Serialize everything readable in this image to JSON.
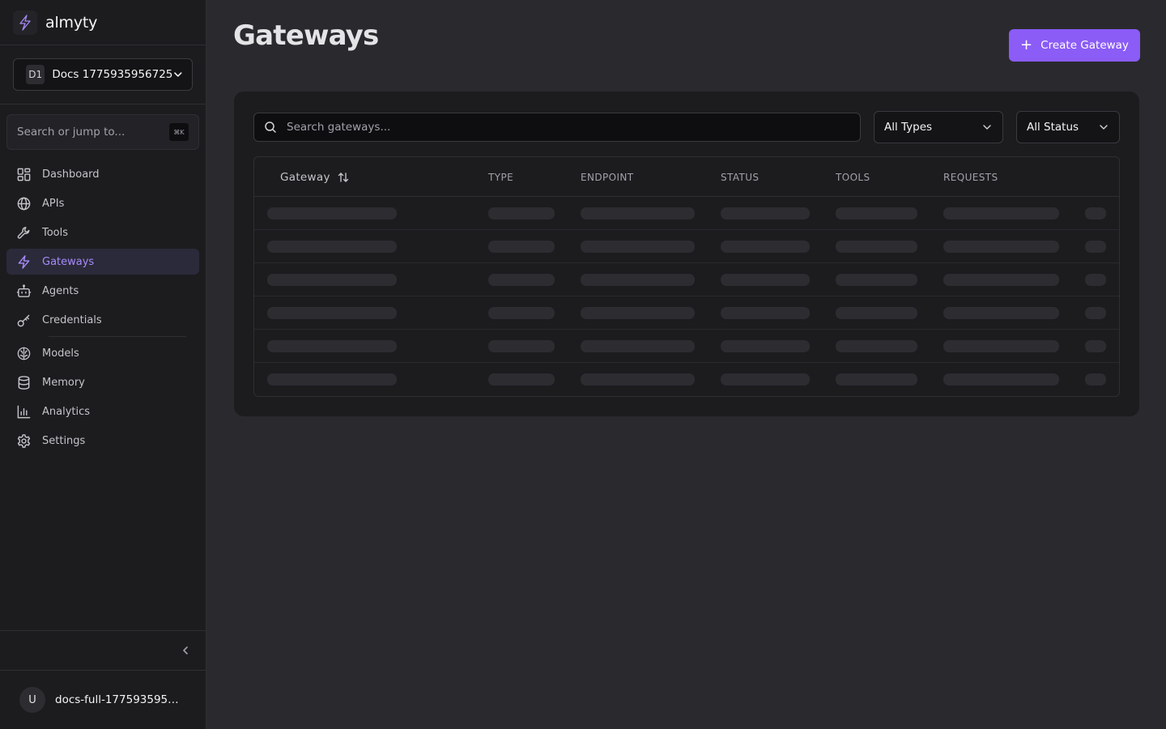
{
  "brand": {
    "name": "almyty"
  },
  "workspace": {
    "badge": "D1",
    "name": "Docs 1775935956725"
  },
  "nav_search": {
    "placeholder": "Search or jump to...",
    "shortcut": "⌘K"
  },
  "nav": {
    "items": [
      {
        "label": "Dashboard",
        "icon": "dashboard-icon"
      },
      {
        "label": "APIs",
        "icon": "globe-icon"
      },
      {
        "label": "Tools",
        "icon": "wrench-icon"
      },
      {
        "label": "Gateways",
        "icon": "lightning-icon",
        "active": true
      },
      {
        "label": "Agents",
        "icon": "robot-icon"
      },
      {
        "label": "Credentials",
        "icon": "key-icon"
      },
      {
        "label": "Models",
        "icon": "brain-icon"
      },
      {
        "label": "Memory",
        "icon": "database-icon"
      },
      {
        "label": "Analytics",
        "icon": "bar-chart-icon"
      },
      {
        "label": "Settings",
        "icon": "gear-icon"
      }
    ]
  },
  "user": {
    "initial": "U",
    "name": "docs-full-1775935956..."
  },
  "page": {
    "title": "Gateways",
    "create_label": "Create Gateway"
  },
  "filters": {
    "search_placeholder": "Search gateways...",
    "type_selected": "All Types",
    "status_selected": "All Status"
  },
  "table": {
    "columns": [
      "Gateway",
      "TYPE",
      "ENDPOINT",
      "STATUS",
      "TOOLS",
      "REQUESTS"
    ],
    "loading_rows": 6
  },
  "colors": {
    "accent": "#8b5cf6",
    "active_nav_text": "#a78bfa",
    "background": "#2a2a2e",
    "sidebar": "#1c1c1f"
  }
}
